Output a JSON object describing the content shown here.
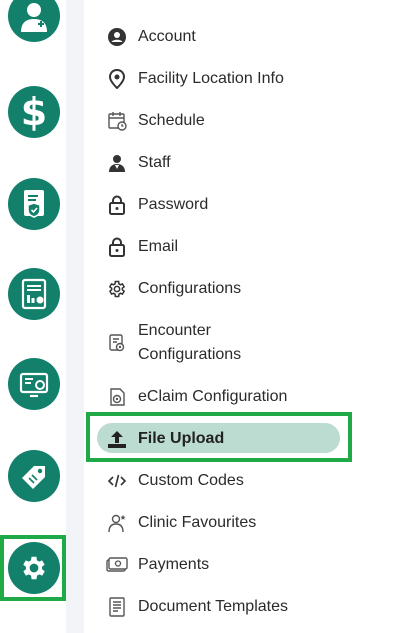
{
  "colors": {
    "rail_icon_bg": "#12806b",
    "highlight_frame": "#1fa947",
    "active_pill": "#bcdcd1",
    "gap_bg": "#f2f4f7"
  },
  "rail": {
    "items": [
      {
        "name": "doctor",
        "icon": "doctor-icon"
      },
      {
        "name": "billing",
        "icon": "dollar-icon",
        "glyph": "$"
      },
      {
        "name": "insurance",
        "icon": "insurance-document-icon"
      },
      {
        "name": "reports",
        "icon": "report-chart-icon"
      },
      {
        "name": "devices",
        "icon": "monitor-gear-icon"
      },
      {
        "name": "tags",
        "icon": "tag-icon"
      },
      {
        "name": "settings",
        "icon": "gear-icon",
        "active": true
      }
    ]
  },
  "menu": {
    "items": [
      {
        "label": "Account",
        "icon": "account-circle-icon"
      },
      {
        "label": "Facility Location Info",
        "icon": "location-pin-icon"
      },
      {
        "label": "Schedule",
        "icon": "calendar-clock-icon"
      },
      {
        "label": "Staff",
        "icon": "staff-person-icon"
      },
      {
        "label": "Password",
        "icon": "lock-icon"
      },
      {
        "label": "Email",
        "icon": "lock-icon"
      },
      {
        "label": "Configurations",
        "icon": "gear-icon"
      },
      {
        "label": "Encounter Configurations",
        "line1": "Encounter",
        "line2": "Configurations",
        "icon": "encounter-config-icon"
      },
      {
        "label": "eClaim Configuration",
        "icon": "eclaim-icon"
      },
      {
        "label": "File Upload",
        "icon": "upload-icon",
        "active": true
      },
      {
        "label": "Custom Codes",
        "icon": "code-icon"
      },
      {
        "label": "Clinic Favourites",
        "icon": "favourites-person-icon"
      },
      {
        "label": "Payments",
        "icon": "payments-icon"
      },
      {
        "label": "Document Templates",
        "icon": "document-template-icon"
      }
    ]
  }
}
